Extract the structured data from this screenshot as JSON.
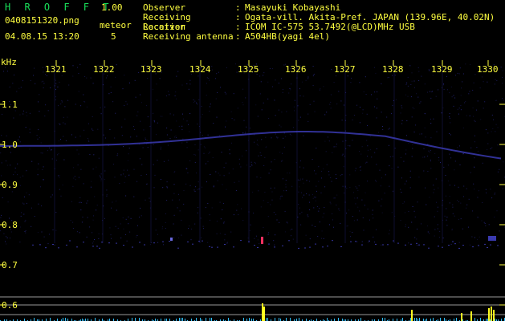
{
  "header": {
    "app_name": "H R O F F T",
    "version": "1.00",
    "filename": "0408151320.png",
    "meteor_label": "meteor",
    "meteor_count": "5",
    "datetime": "04.08.15 13:20",
    "info": [
      {
        "key": "Observer",
        "value": "Masayuki Kobayashi"
      },
      {
        "key": "Receiving Location",
        "value": "Ogata-vill. Akita-Pref. JAPAN (139.96E, 40.02N)"
      },
      {
        "key": "Receiver",
        "value": "ICOM IC-575 53.7492(@LCD)MHz USB"
      },
      {
        "key": "Receiving antenna",
        "value": "A504HB(yagi 4el)"
      }
    ],
    "separator": ":"
  },
  "plot": {
    "y_unit": "kHz",
    "time_ticks": [
      "1321",
      "1322",
      "1323",
      "1324",
      "1325",
      "1326",
      "1327",
      "1328",
      "1329",
      "1330"
    ],
    "freq_ticks": [
      {
        "label": "1.1",
        "value": 1.1
      },
      {
        "label": "1.0",
        "value": 1.0
      },
      {
        "label": "0.9",
        "value": 0.9
      },
      {
        "label": "0.8",
        "value": 0.8
      },
      {
        "label": "0.7",
        "value": 0.7
      },
      {
        "label": "0.6",
        "value": 0.6
      }
    ],
    "colors": {
      "text": "#ffff40",
      "tick_label": "#ffff40",
      "background": "#000000",
      "noise": "#2a2a8a",
      "trace": "#3a3ab0",
      "meteor_echo": "#ff3060",
      "level_bar": "#ffff20",
      "level_low": "#30c0ff"
    }
  }
}
